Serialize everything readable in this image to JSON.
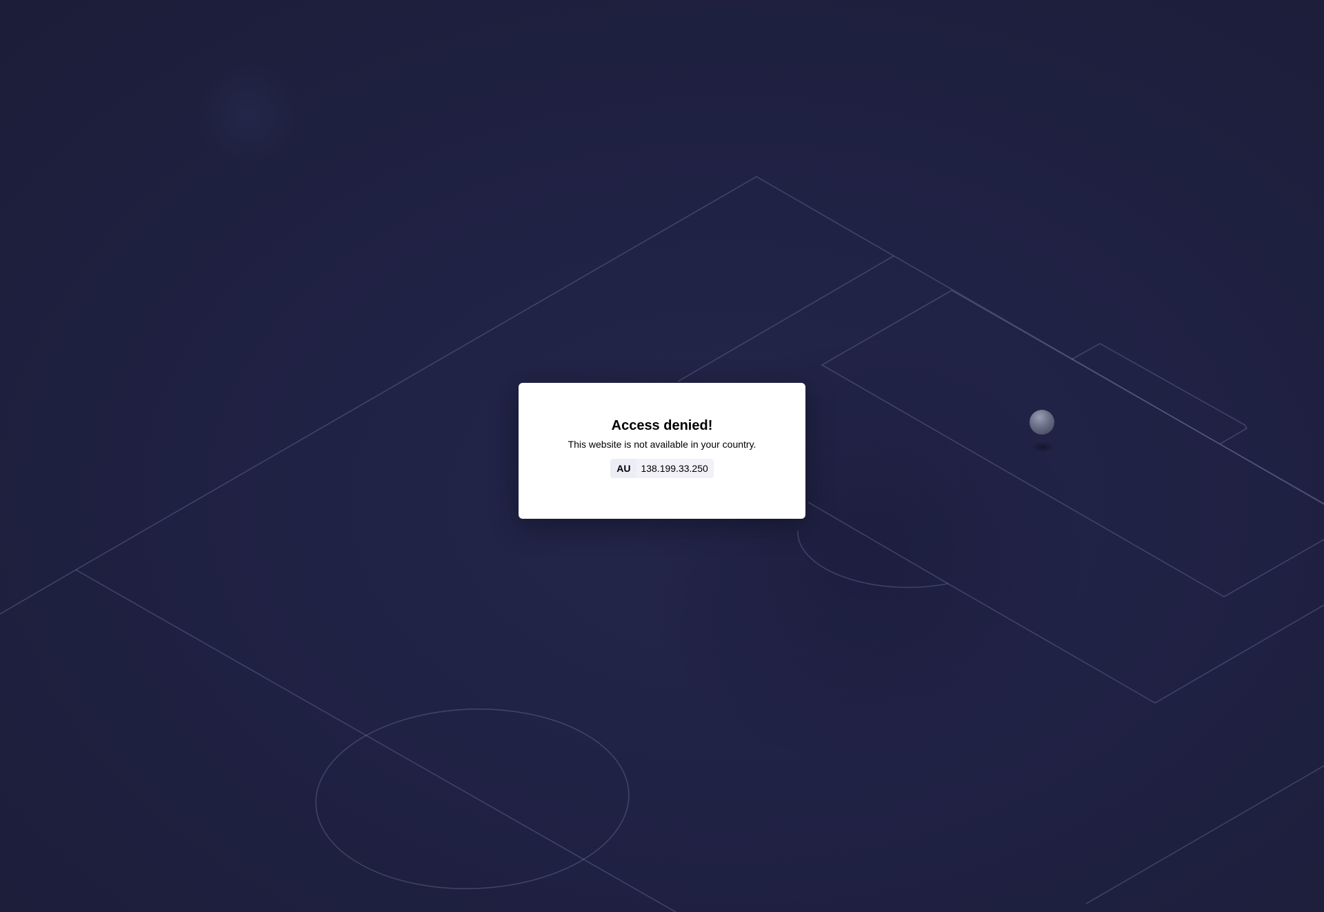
{
  "dialog": {
    "title": "Access denied!",
    "message": "This website is not available in your country.",
    "country_code": "AU",
    "ip_address": "138.199.33.250"
  },
  "colors": {
    "background": "#202245",
    "pitch_lines": "#8c91b9",
    "dialog_background": "#ffffff"
  },
  "icons": {
    "background_illustration": "soccer-pitch",
    "ball": "football-icon"
  }
}
